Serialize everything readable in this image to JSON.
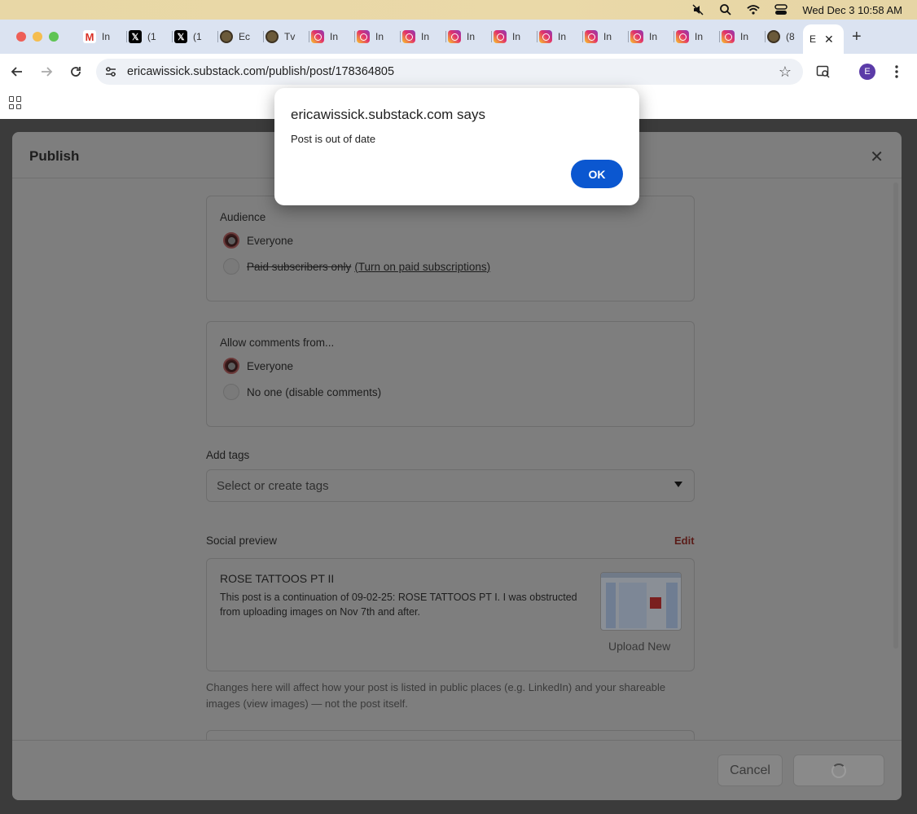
{
  "menubar": {
    "datetime": "Wed Dec 3  10:58 AM",
    "icons": [
      "mute-icon",
      "search-icon",
      "wifi-icon",
      "control-center-icon"
    ]
  },
  "tabs": [
    {
      "icon": "gmail-icon",
      "label": "In"
    },
    {
      "icon": "x-icon",
      "label": "(1"
    },
    {
      "icon": "x-icon",
      "label": "(1"
    },
    {
      "icon": "coin-icon",
      "label": "Ec"
    },
    {
      "icon": "coin-icon",
      "label": "Tv"
    },
    {
      "icon": "instagram-icon",
      "label": "In"
    },
    {
      "icon": "instagram-icon",
      "label": "In"
    },
    {
      "icon": "instagram-icon",
      "label": "In"
    },
    {
      "icon": "instagram-icon",
      "label": "In"
    },
    {
      "icon": "instagram-icon",
      "label": "In"
    },
    {
      "icon": "instagram-icon",
      "label": "In"
    },
    {
      "icon": "instagram-icon",
      "label": "In"
    },
    {
      "icon": "instagram-icon",
      "label": "In"
    },
    {
      "icon": "instagram-icon",
      "label": "In"
    },
    {
      "icon": "instagram-icon",
      "label": "In"
    },
    {
      "icon": "coin-icon",
      "label": "(8"
    }
  ],
  "active_tab": {
    "label": "E"
  },
  "browser": {
    "url": "ericawissick.substack.com/publish/post/178364805",
    "profile_initial": "E"
  },
  "modal": {
    "title": "Publish",
    "audience": {
      "title": "Audience",
      "option_everyone": "Everyone",
      "option_paid": "Paid subscribers only",
      "paid_link": "(Turn on paid subscriptions)"
    },
    "comments": {
      "title": "Allow comments from...",
      "option_everyone": "Everyone",
      "option_none": "No one (disable comments)"
    },
    "tags": {
      "label": "Add tags",
      "placeholder": "Select or create tags"
    },
    "social": {
      "label": "Social preview",
      "edit": "Edit",
      "post_title": "ROSE TATTOOS PT II",
      "post_desc": "This post is a continuation of 09-02-25: ROSE TATTOOS PT I. I was obstructed from uploading images on Nov 7th and after.",
      "upload_new": "Upload New",
      "help": "Changes here will affect how your post is listed in public places (e.g. LinkedIn) and your shareable images (view images) — not the post itself."
    },
    "footer": {
      "cancel": "Cancel"
    }
  },
  "alert": {
    "title": "ericawissick.substack.com says",
    "message": "Post is out of date",
    "ok": "OK"
  },
  "colors": {
    "accent_blue": "#0b57d0",
    "edit_link": "#5a1c18",
    "tab_strip": "#dbe3f1"
  }
}
